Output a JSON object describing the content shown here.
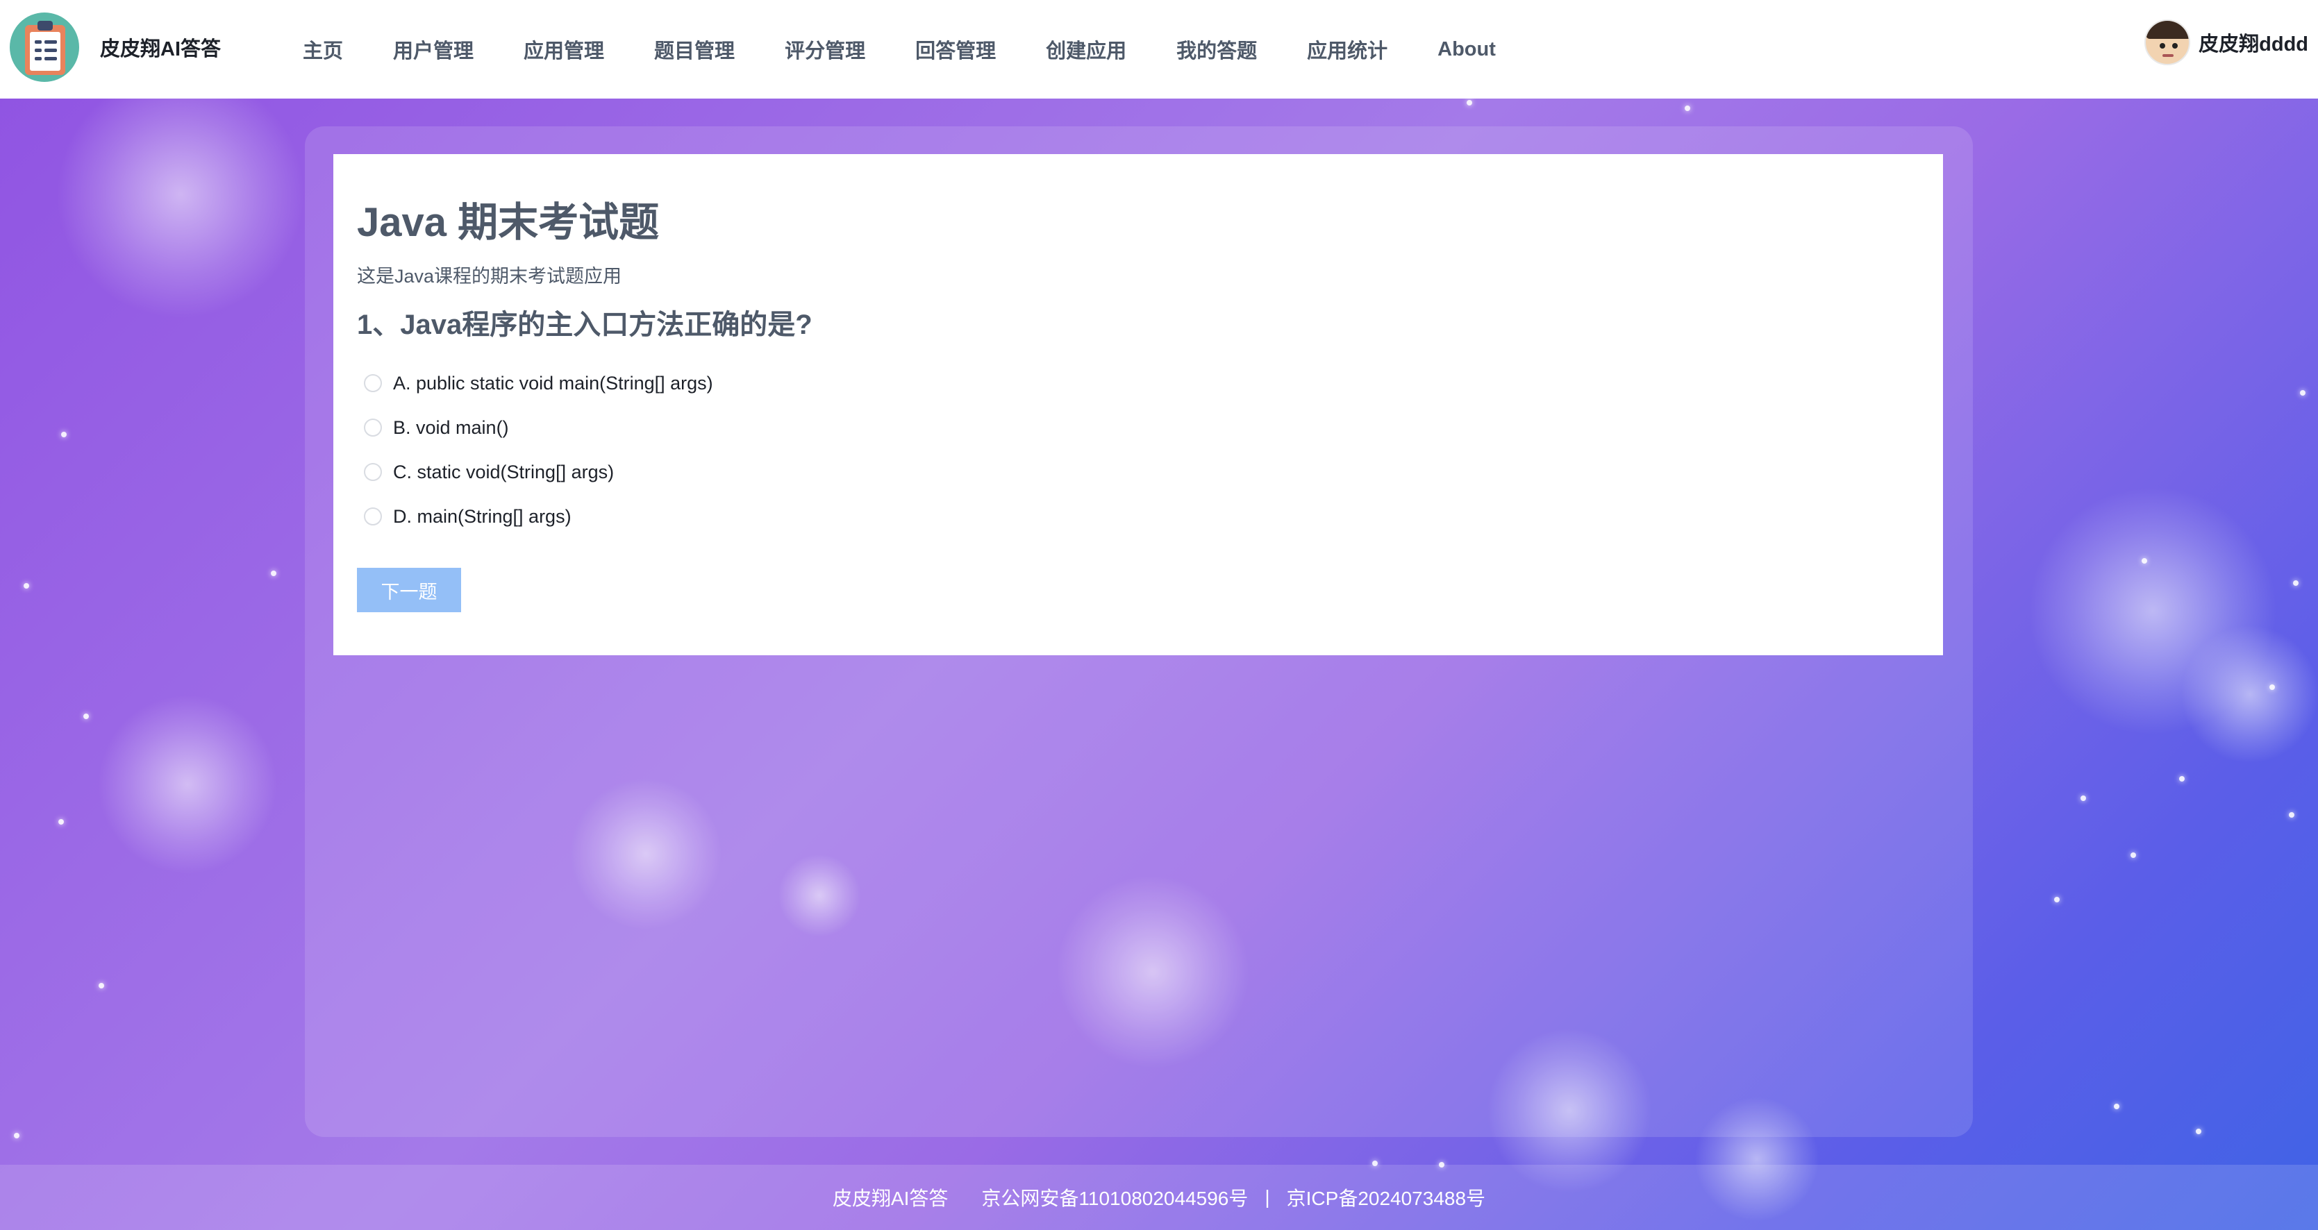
{
  "brand": {
    "name": "皮皮翔AI答答",
    "logo_icon": "clipboard-logo-icon"
  },
  "nav": {
    "items": [
      "主页",
      "用户管理",
      "应用管理",
      "题目管理",
      "评分管理",
      "回答管理",
      "创建应用",
      "我的答题",
      "应用统计",
      "About"
    ]
  },
  "user": {
    "name": "皮皮翔dddd",
    "avatar_icon": "user-avatar-icon"
  },
  "quiz": {
    "title": "Java 期末考试题",
    "description": "这是Java课程的期末考试题应用",
    "question": "1、Java程序的主入口方法正确的是?",
    "options": [
      "A. public static void main(String[] args)",
      "B. void main()",
      "C. static void(String[] args)",
      "D. main(String[] args)"
    ],
    "next_label": "下一题"
  },
  "footer": {
    "brand": "皮皮翔AI答答",
    "police_record": "京公网安备11010802044596号",
    "separator": "|",
    "icp_record": "京ICP备2024073488号"
  },
  "colors": {
    "text_primary": "#4e5969",
    "button_disabled": "#94bff7",
    "bg_purple": "#8f52e2",
    "bg_blue": "#3f63e6"
  }
}
